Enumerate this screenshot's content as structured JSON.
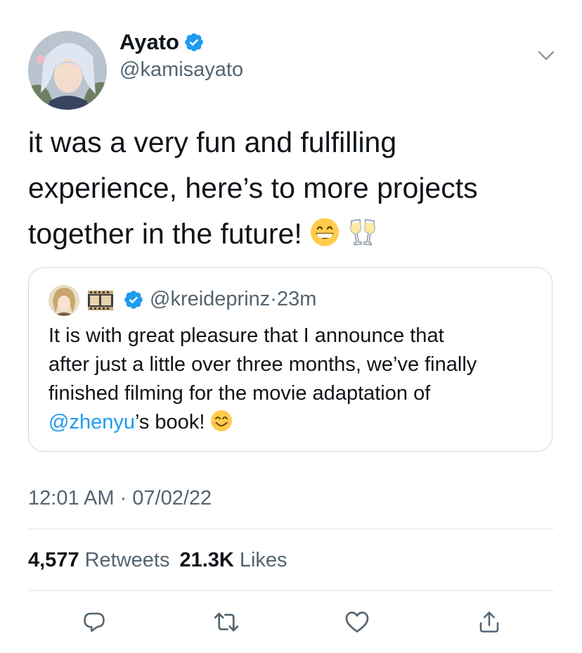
{
  "author": {
    "display_name": "Ayato",
    "handle": "@kamisayato",
    "verified": true
  },
  "tweet": {
    "lines": [
      "it was a very fun and fulfilling",
      "experience, here’s to more projects",
      "together in the future!"
    ],
    "emojis": [
      "grinning-face-emoji",
      "clinking-glasses-emoji"
    ]
  },
  "quoted_tweet": {
    "handle": "@kreideprinz",
    "separator": "·",
    "time": "23m",
    "verified": true,
    "lines": [
      "It is with great pleasure that I announce that",
      "after just a little over three months, we’ve finally",
      "finished filming for the movie adaptation of"
    ],
    "last_line": {
      "mention": "@zhenyu",
      "rest": "’s book!"
    },
    "emoji": "smiling-face-emoji"
  },
  "timestamp": "12:01 AM · 07/02/22",
  "stats": {
    "retweets_count": "4,577",
    "retweets_label": "Retweets",
    "likes_count": "21.3K",
    "likes_label": "Likes"
  },
  "actions": [
    "reply-icon",
    "retweet-icon",
    "like-icon",
    "share-icon"
  ],
  "colors": {
    "accent": "#1d9bf0",
    "secondary_text": "#536471",
    "border": "#cfd9de"
  }
}
